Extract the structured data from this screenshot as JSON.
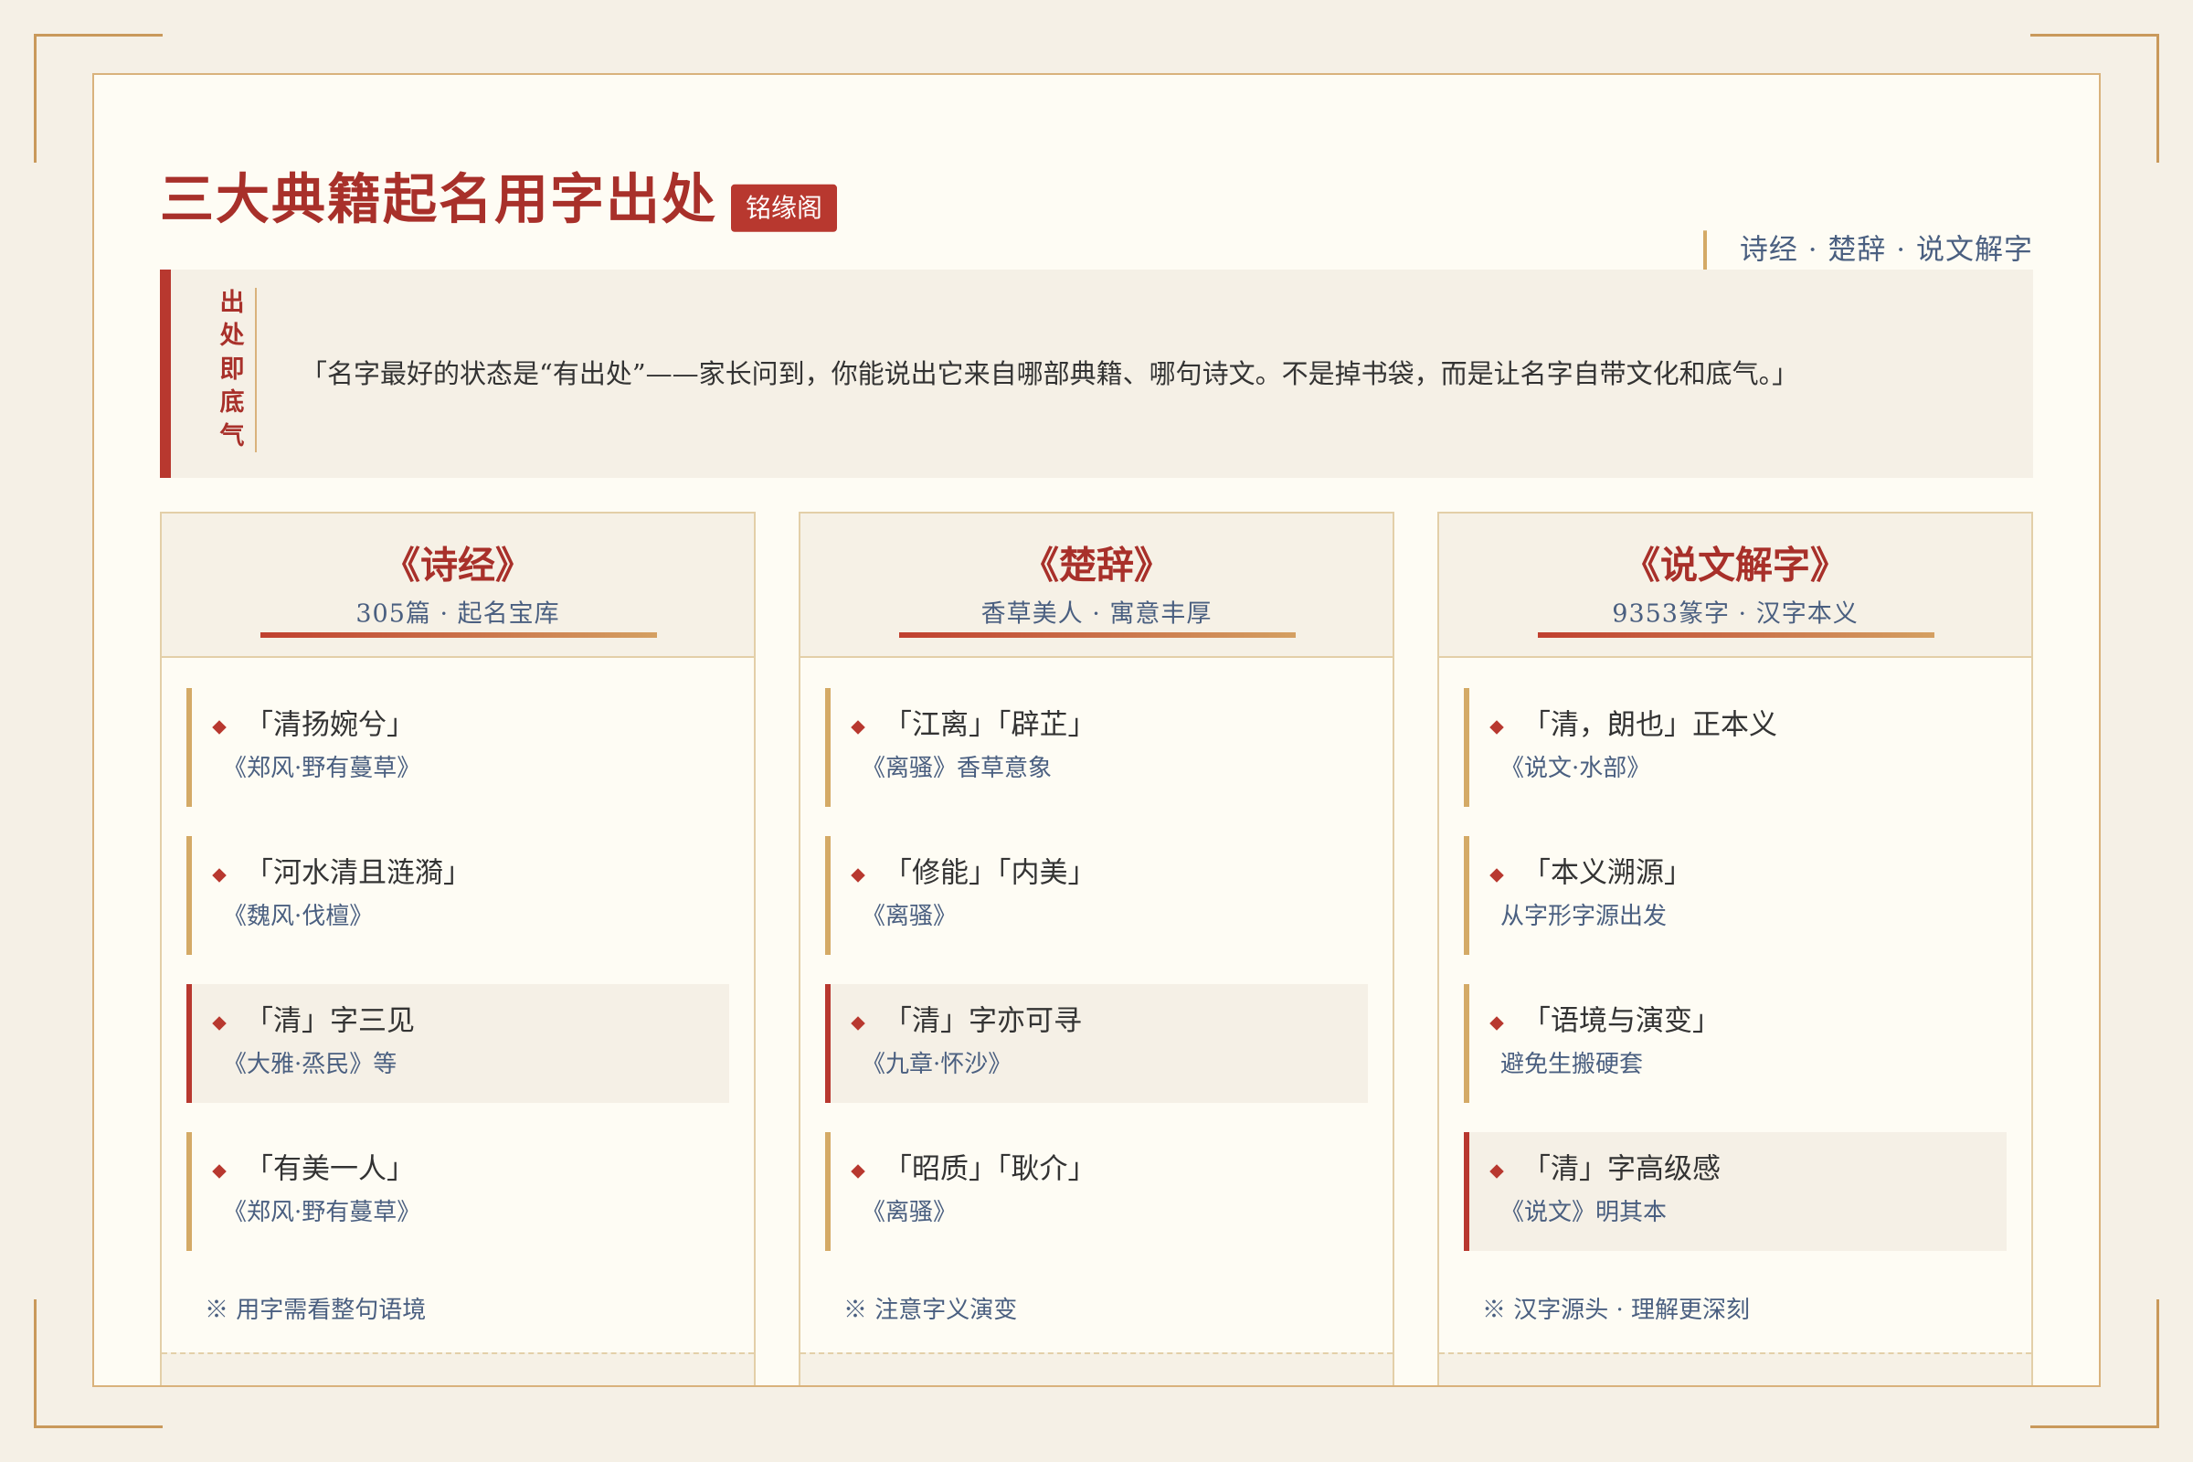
{
  "header": {
    "title": "三大典籍起名用字出处",
    "badge": "铭缘阁",
    "subtitle": "诗经 · 楚辞 · 说文解字"
  },
  "quote": {
    "tag": [
      "出",
      "处",
      "即",
      "底",
      "气"
    ],
    "text": "「名字最好的状态是“有出处”——家长问到，你能说出它来自哪部典籍、哪句诗文。不是掉书袋，而是让名字自带文化和底气。」"
  },
  "columns": [
    {
      "title": "《诗经》",
      "subtitle": "305篇 · 起名宝库",
      "items": [
        {
          "title": "「清扬婉兮」",
          "source": "《郑风·野有蔓草》",
          "highlight": false
        },
        {
          "title": "「河水清且涟漪」",
          "source": "《魏风·伐檀》",
          "highlight": false
        },
        {
          "title": "「清」字三见",
          "source": "《大雅·烝民》等",
          "highlight": true
        },
        {
          "title": "「有美一人」",
          "source": "《郑风·野有蔓草》",
          "highlight": false
        }
      ],
      "note": "※ 用字需看整句语境"
    },
    {
      "title": "《楚辞》",
      "subtitle": "香草美人 · 寓意丰厚",
      "items": [
        {
          "title": "「江离」「辟芷」",
          "source": "《离骚》香草意象",
          "highlight": false
        },
        {
          "title": "「修能」「内美」",
          "source": "《离骚》",
          "highlight": false
        },
        {
          "title": "「清」字亦可寻",
          "source": "《九章·怀沙》",
          "highlight": true
        },
        {
          "title": "「昭质」「耿介」",
          "source": "《离骚》",
          "highlight": false
        }
      ],
      "note": "※ 注意字义演变"
    },
    {
      "title": "《说文解字》",
      "subtitle": "9353篆字 · 汉字本义",
      "items": [
        {
          "title": "「清，朗也」正本义",
          "source": "《说文·水部》",
          "highlight": false
        },
        {
          "title": "「本义溯源」",
          "source": "从字形字源出发",
          "highlight": false
        },
        {
          "title": "「语境与演变」",
          "source": "避免生搬硬套",
          "highlight": false
        },
        {
          "title": "「清」字高级感",
          "source": "《说文》明其本",
          "highlight": true
        }
      ],
      "note": "※ 汉字源头 · 理解更深刻"
    }
  ]
}
